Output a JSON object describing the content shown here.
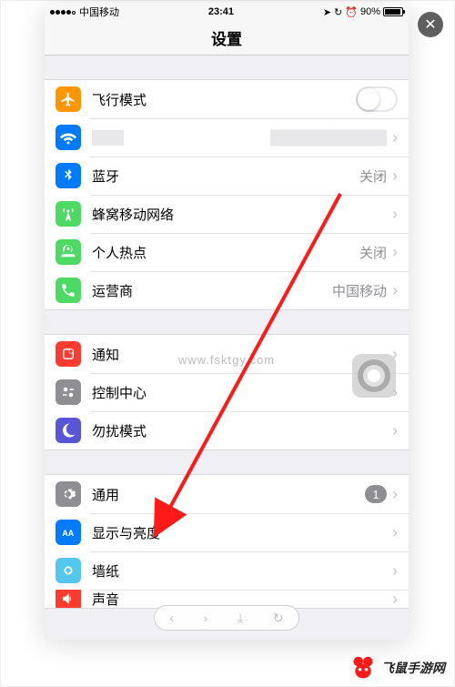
{
  "status_bar": {
    "carrier": "中国移动",
    "time": "23:41",
    "battery_pct": "90%"
  },
  "nav": {
    "title": "设置"
  },
  "groups": [
    {
      "rows": [
        {
          "id": "airplane",
          "label": "飞行模式",
          "icon_color": "#ff9500",
          "control": "toggle"
        },
        {
          "id": "wifi",
          "label": "Wi-Fi",
          "icon_color": "#007aff",
          "value_blur": true,
          "chevron": true
        },
        {
          "id": "bluetooth",
          "label": "蓝牙",
          "icon_color": "#007aff",
          "value": "关闭",
          "chevron": true
        },
        {
          "id": "cellular",
          "label": "蜂窝移动网络",
          "icon_color": "#4cd964",
          "chevron": true
        },
        {
          "id": "hotspot",
          "label": "个人热点",
          "icon_color": "#4cd964",
          "value": "关闭",
          "chevron": true
        },
        {
          "id": "carrier",
          "label": "运营商",
          "icon_color": "#4cd964",
          "value": "中国移动",
          "chevron": true
        }
      ]
    },
    {
      "rows": [
        {
          "id": "notifications",
          "label": "通知",
          "icon_color": "#ff3b30",
          "chevron": true
        },
        {
          "id": "controlcenter",
          "label": "控制中心",
          "icon_color": "#8e8e93",
          "chevron": true
        },
        {
          "id": "dnd",
          "label": "勿扰模式",
          "icon_color": "#5856d6",
          "chevron": true
        }
      ]
    },
    {
      "rows": [
        {
          "id": "general",
          "label": "通用",
          "icon_color": "#8e8e93",
          "badge": "1",
          "chevron": true
        },
        {
          "id": "display",
          "label": "显示与亮度",
          "icon_color": "#007aff",
          "chevron": true
        },
        {
          "id": "wallpaper",
          "label": "墙纸",
          "icon_color": "#54c7ec",
          "chevron": true
        },
        {
          "id": "sound",
          "label": "声音",
          "icon_color": "#ff3b30",
          "chevron": true,
          "cut": true
        }
      ]
    }
  ],
  "watermark": {
    "text": "飞鼠手游网",
    "url": "www.fsktgy.com"
  }
}
